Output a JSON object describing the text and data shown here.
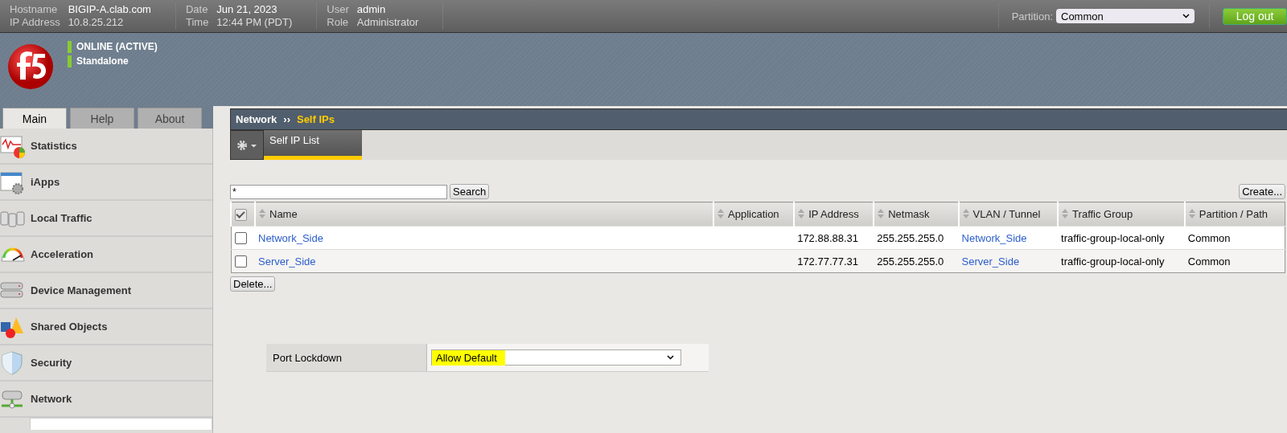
{
  "top_bar": {
    "groups": [
      {
        "labels": [
          "Hostname",
          "IP Address"
        ],
        "values": [
          "BIGIP-A.clab.com",
          "10.8.25.212"
        ]
      },
      {
        "labels": [
          "Date",
          "Time"
        ],
        "values": [
          "Jun 21, 2023",
          "12:44 PM (PDT)"
        ]
      },
      {
        "labels": [
          "User",
          "Role"
        ],
        "values": [
          "admin",
          "Administrator"
        ]
      }
    ],
    "partition": {
      "label": "Partition:",
      "value": "Common"
    },
    "logout": "Log out"
  },
  "status": [
    "ONLINE (ACTIVE)",
    "Standalone"
  ],
  "tabs": [
    {
      "label": "Main",
      "selected": true
    },
    {
      "label": "Help",
      "selected": false
    },
    {
      "label": "About",
      "selected": false
    }
  ],
  "sidebar": {
    "items": [
      {
        "label": "Statistics"
      },
      {
        "label": "iApps"
      },
      {
        "label": "Local Traffic"
      },
      {
        "label": "Acceleration"
      },
      {
        "label": "Device Management"
      },
      {
        "label": "Shared Objects"
      },
      {
        "label": "Security"
      },
      {
        "label": "Network"
      }
    ]
  },
  "breadcrumb": {
    "parent": "Network",
    "separator": "››",
    "current": "Self IPs"
  },
  "subtabs": [
    {
      "label": "Self IP List",
      "selected": true
    }
  ],
  "search": {
    "value": "*",
    "button": "Search"
  },
  "create_button": "Create...",
  "table": {
    "select_all_checked": true,
    "columns": [
      "Name",
      "Application",
      "IP Address",
      "Netmask",
      "VLAN / Tunnel",
      "Traffic Group",
      "Partition / Path"
    ],
    "rows": [
      {
        "checked": false,
        "name": "Network_Side",
        "ip": "172.88.88.31",
        "netmask": "255.255.255.0",
        "vlan": "Network_Side",
        "traffic_group": "traffic-group-local-only",
        "partition": "Common"
      },
      {
        "checked": false,
        "name": "Server_Side",
        "ip": "172.77.77.31",
        "netmask": "255.255.255.0",
        "vlan": "Server_Side",
        "traffic_group": "traffic-group-local-only",
        "partition": "Common"
      }
    ]
  },
  "delete_button": "Delete...",
  "port_lockdown": {
    "label": "Port Lockdown",
    "value": "Allow Default",
    "highlighted": true
  }
}
